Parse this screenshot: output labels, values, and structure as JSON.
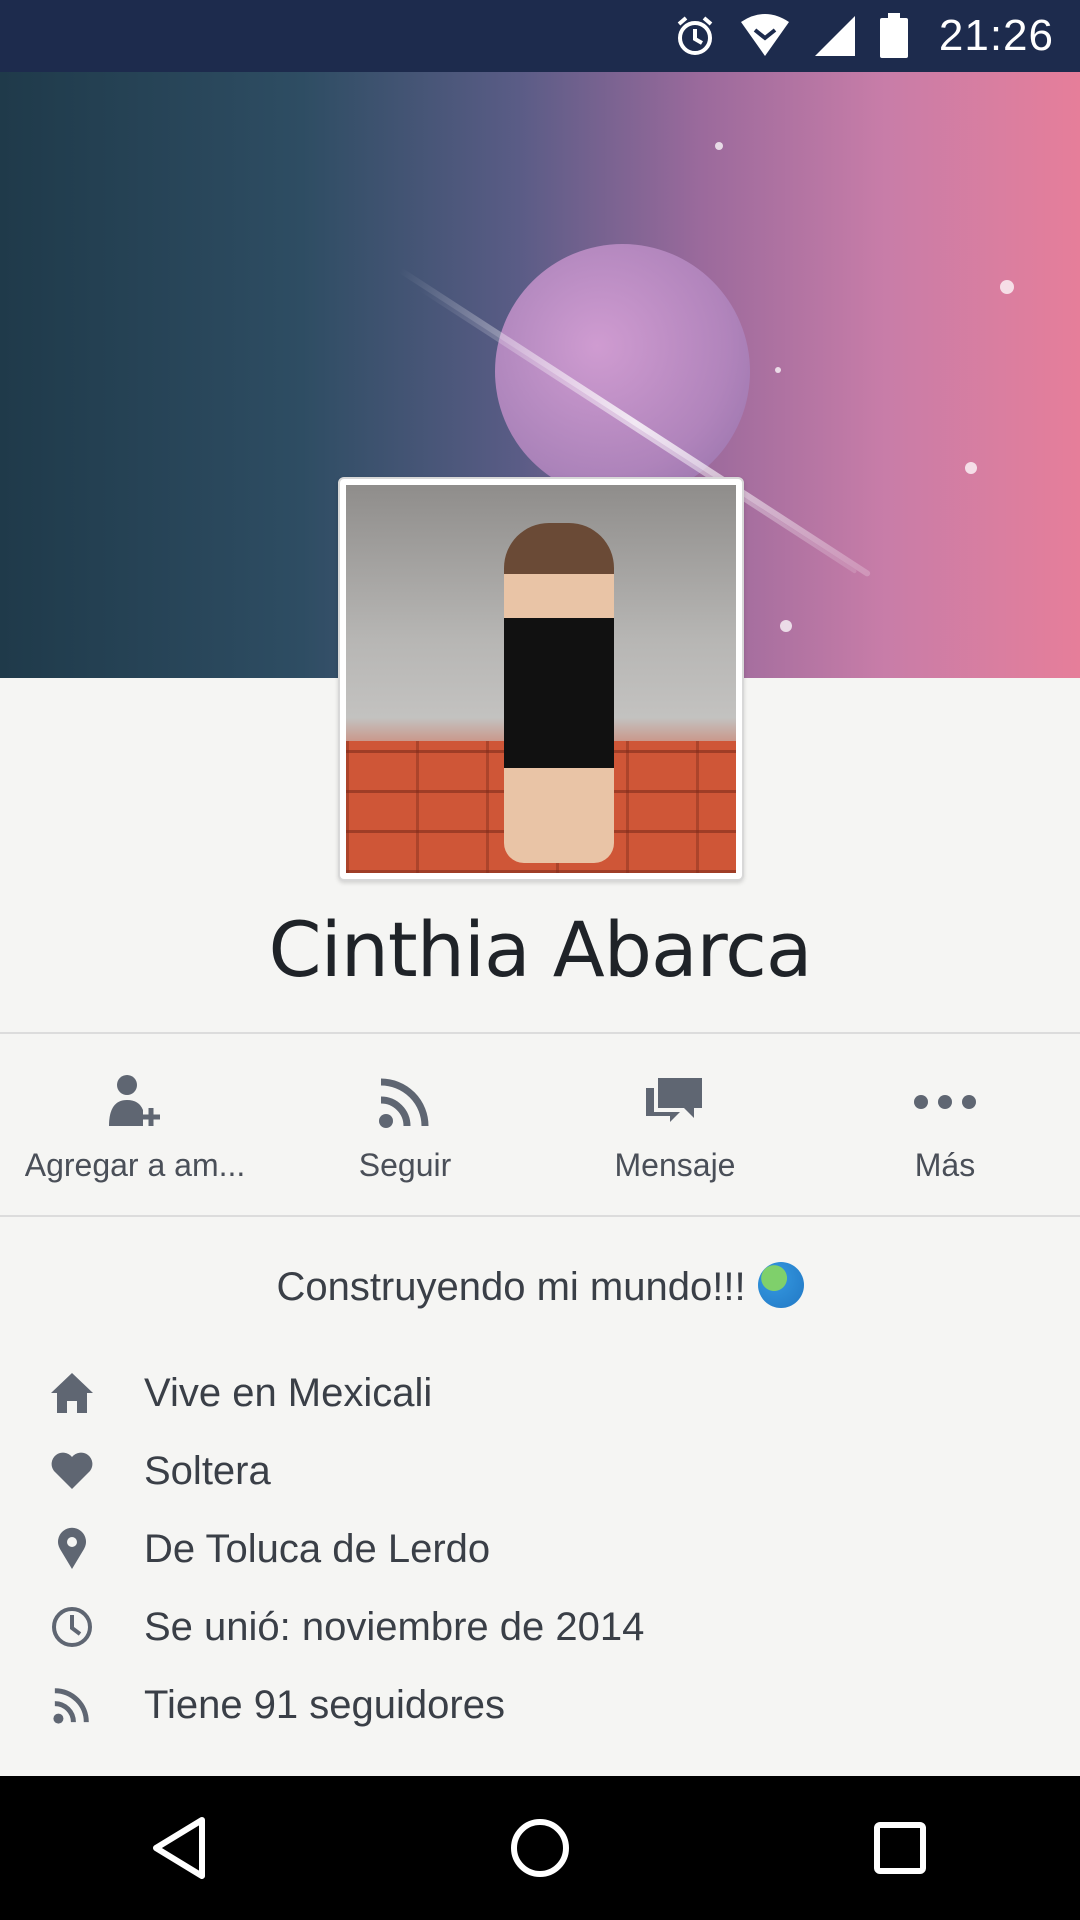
{
  "status_bar": {
    "time": "21:26",
    "icons": [
      "alarm-icon",
      "wifi-icon",
      "cell-signal-icon",
      "battery-icon"
    ]
  },
  "profile": {
    "name": "Cinthia Abarca",
    "bio": "Construyendo mi mundo!!!"
  },
  "actions": [
    {
      "label": "Agregar a am...",
      "icon": "add-friend-icon"
    },
    {
      "label": "Seguir",
      "icon": "follow-rss-icon"
    },
    {
      "label": "Mensaje",
      "icon": "message-icon"
    },
    {
      "label": "Más",
      "icon": "more-dots-icon"
    }
  ],
  "info": [
    {
      "text": "Vive en Mexicali",
      "icon": "home-icon"
    },
    {
      "text": "Soltera",
      "icon": "heart-icon"
    },
    {
      "text": "De Toluca de Lerdo",
      "icon": "location-pin-icon"
    },
    {
      "text": "Se unió: noviembre de 2014",
      "icon": "clock-icon"
    },
    {
      "text": "Tiene 91 seguidores",
      "icon": "rss-icon"
    }
  ],
  "colors": {
    "status_bar": "#1d2b4d",
    "background": "#f5f5f3",
    "icon_gray": "#5f6672",
    "text": "#3a3f47",
    "nav_bar": "#000000"
  },
  "nav": [
    "back-icon",
    "home-circle-icon",
    "recents-icon"
  ]
}
